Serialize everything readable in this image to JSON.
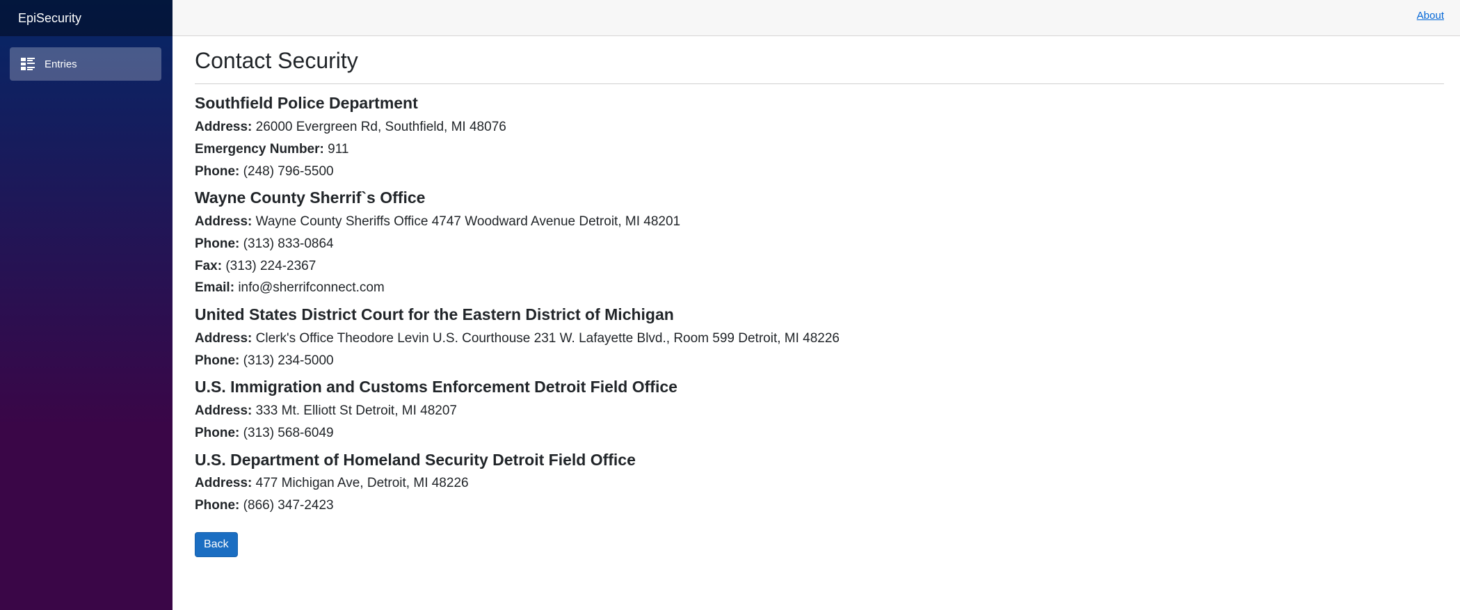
{
  "app": {
    "brand": "EpiSecurity",
    "nav": [
      {
        "label": "Entries",
        "icon": "list-icon"
      }
    ],
    "about_link": "About"
  },
  "page": {
    "title": "Contact Security",
    "back_label": "Back"
  },
  "agencies": [
    {
      "name": "Southfield Police Department",
      "fields": [
        {
          "label": "Address:",
          "value": "26000 Evergreen Rd, Southfield, MI 48076"
        },
        {
          "label": "Emergency Number:",
          "value": "911"
        },
        {
          "label": "Phone:",
          "value": "(248) 796-5500"
        }
      ]
    },
    {
      "name": "Wayne County Sherrif`s Office",
      "fields": [
        {
          "label": "Address:",
          "value": "Wayne County Sheriffs Office 4747 Woodward Avenue Detroit, MI 48201"
        },
        {
          "label": "Phone:",
          "value": "(313) 833-0864"
        },
        {
          "label": "Fax:",
          "value": "(313) 224-2367"
        },
        {
          "label": "Email:",
          "value": "info@sherrifconnect.com"
        }
      ]
    },
    {
      "name": "United States District Court for the Eastern District of Michigan",
      "fields": [
        {
          "label": "Address:",
          "value": "Clerk's Office Theodore Levin U.S. Courthouse 231 W. Lafayette Blvd., Room 599 Detroit, MI 48226"
        },
        {
          "label": "Phone:",
          "value": "(313) 234-5000"
        }
      ]
    },
    {
      "name": "U.S. Immigration and Customs Enforcement Detroit Field Office",
      "fields": [
        {
          "label": "Address:",
          "value": "333 Mt. Elliott St Detroit, MI 48207"
        },
        {
          "label": "Phone:",
          "value": "(313) 568-6049"
        }
      ]
    },
    {
      "name": "U.S. Department of Homeland Security Detroit Field Office",
      "fields": [
        {
          "label": "Address:",
          "value": "477 Michigan Ave, Detroit, MI 48226"
        },
        {
          "label": "Phone:",
          "value": "(866) 347-2423"
        }
      ]
    }
  ],
  "colors": {
    "accent": "#1b6ec2",
    "link": "#0366d6",
    "sidebar_top": "#052767",
    "sidebar_bottom": "#3a0647"
  }
}
